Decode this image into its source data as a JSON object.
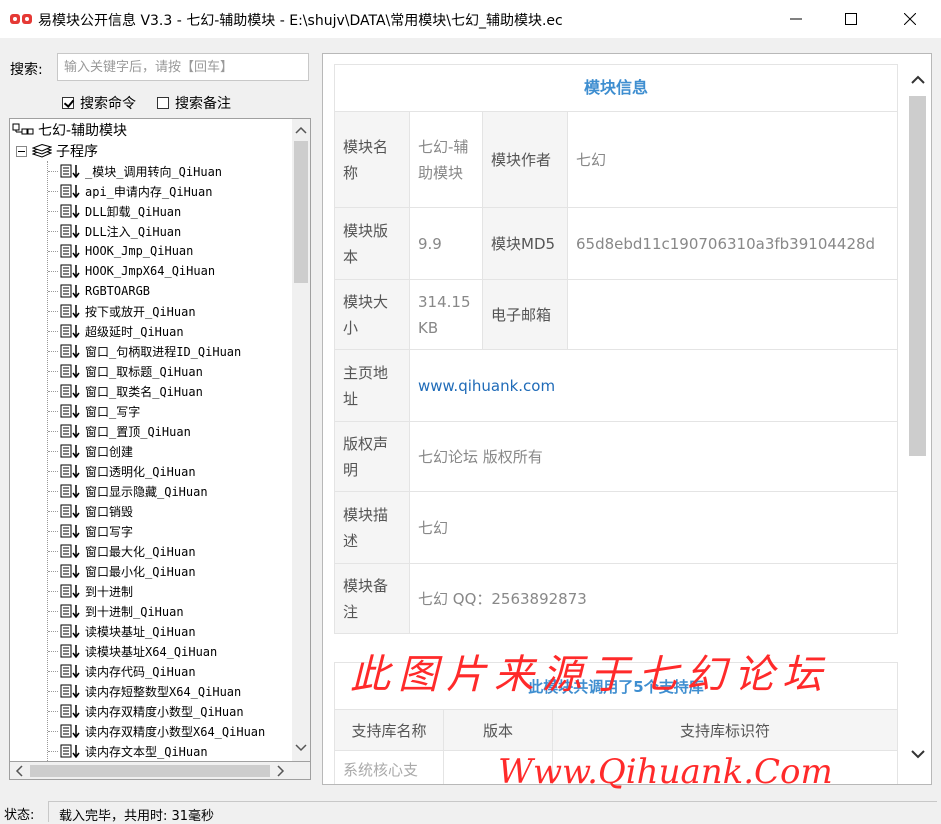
{
  "window": {
    "title": "易模块公开信息 V3.3 - 七幻-辅助模块 - E:\\shujv\\DATA\\常用模块\\七幻_辅助模块.ec"
  },
  "search": {
    "label": "搜索:",
    "placeholder": "输入关键字后，请按【回车】",
    "options": [
      {
        "label": "搜索命令",
        "checked": true
      },
      {
        "label": "搜索备注",
        "checked": false
      }
    ]
  },
  "tree": {
    "root": "七幻-辅助模块",
    "category": "子程序",
    "items": [
      "_模块_调用转向_QiHuan",
      "api_申请内存_QiHuan",
      "DLL卸载_QiHuan",
      "DLL注入_QiHuan",
      "HOOK_Jmp_QiHuan",
      "HOOK_JmpX64_QiHuan",
      "RGBTOARGB",
      "按下或放开_QiHuan",
      "超级延时_QiHuan",
      "窗口_句柄取进程ID_QiHuan",
      "窗口_取标题_QiHuan",
      "窗口_取类名_QiHuan",
      "窗口_写字",
      "窗口_置顶_QiHuan",
      "窗口创建",
      "窗口透明化_QiHuan",
      "窗口显示隐藏_QiHuan",
      "窗口销毁",
      "窗口写字",
      "窗口最大化_QiHuan",
      "窗口最小化_QiHuan",
      "到十进制",
      "到十进制_QiHuan",
      "读模块基址_QiHuan",
      "读模块基址X64_QiHuan",
      "读内存代码_QiHuan",
      "读内存短整数型X64_QiHuan",
      "读内存双精度小数型_QiHuan",
      "读内存双精度小数型X64_QiHuan",
      "读内存文本型_QiHuan"
    ]
  },
  "module_info": {
    "header": "模块信息",
    "name_label": "模块名称",
    "name_value": "七幻-辅助模块",
    "author_label": "模块作者",
    "author_value": "七幻",
    "version_label": "模块版本",
    "version_value": "9.9",
    "md5_label": "模块MD5",
    "md5_value": "65d8ebd11c190706310a3fb39104428d",
    "size_label": "模块大小",
    "size_value": "314.15 KB",
    "email_label": "电子邮箱",
    "email_value": "",
    "home_label": "主页地址",
    "home_value": "www.qihuank.com",
    "copyright_label": "版权声明",
    "copyright_value": "七幻论坛 版权所有",
    "desc_label": "模块描述",
    "desc_value": "七幻",
    "note_label": "模块备注",
    "note_value": "七幻  QQ：2563892873"
  },
  "libraries": {
    "header": "此模块共调用了5个支持库",
    "col_name": "支持库名称",
    "col_version": "版本",
    "col_id": "支持库标识符",
    "first_row_name": "系统核心支"
  },
  "watermark": {
    "line1": "此图片来源于七幻论坛",
    "line2": "Www.Qihuank.Com"
  },
  "status": {
    "label": "状态:",
    "text": "载入完毕，共用时: 31毫秒"
  },
  "colors": {
    "accent": "#3e8ed0",
    "link": "#1f6bb8",
    "watermark": "#ff2a2a"
  }
}
